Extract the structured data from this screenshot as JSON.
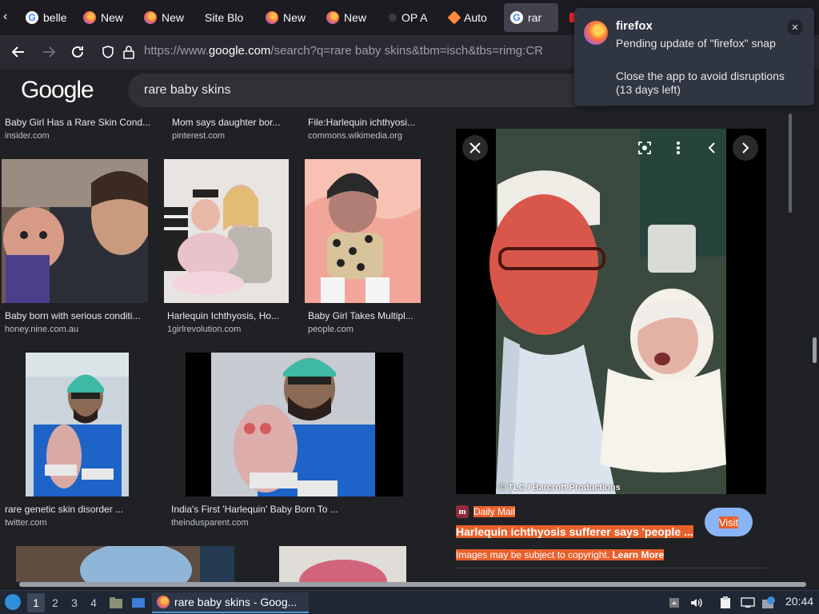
{
  "tabs": [
    {
      "label": "belle",
      "icon": "google-icon"
    },
    {
      "label": "New",
      "icon": "firefox-icon"
    },
    {
      "label": "New",
      "icon": "firefox-icon"
    },
    {
      "label": "Site Blo",
      "icon": "none"
    },
    {
      "label": "New",
      "icon": "firefox-icon"
    },
    {
      "label": "New",
      "icon": "firefox-icon"
    },
    {
      "label": "OP A",
      "icon": "dot-icon"
    },
    {
      "label": "Auto",
      "icon": "diamond-icon"
    },
    {
      "label": "rar",
      "icon": "google-icon",
      "active": true
    }
  ],
  "navbar": {
    "url_prefix": "https://www.",
    "url_host": "google.com",
    "url_path": "/search?q=rare baby skins&tbm=isch&tbs=rimg:CR"
  },
  "google": {
    "logo": "Google",
    "query": "rare baby skins"
  },
  "results": [
    {
      "title": "Baby Girl Has a Rare Skin Cond...",
      "source": "insider.com"
    },
    {
      "title": "Mom says daughter bor...",
      "source": "pinterest.com"
    },
    {
      "title": "File:Harlequin ichthyosi...",
      "source": "commons.wikimedia.org"
    },
    {
      "title": "Baby born with serious conditi...",
      "source": "honey.nine.com.au"
    },
    {
      "title": "Harlequin Ichthyosis, Ho...",
      "source": "1girlrevolution.com"
    },
    {
      "title": "Baby Girl Takes Multipl...",
      "source": "people.com"
    },
    {
      "title": "rare genetic skin disorder ...",
      "source": "twitter.com"
    },
    {
      "title": "India's First 'Harlequin' Baby Born To ...",
      "source": "theindusparent.com"
    }
  ],
  "preview": {
    "credit": "© TLC / Barcroft Productions",
    "site": "Daily Mail",
    "headline": "Harlequin ichthyosis sufferer says 'people ...",
    "copyright": "Images may be subject to copyright.",
    "learn_more": "Learn More",
    "visit": "Visit"
  },
  "notification": {
    "app": "firefox",
    "message": "Pending update of \"firefox\" snap",
    "detail": "Close the app to avoid disruptions (13 days left)"
  },
  "taskbar": {
    "workspaces": [
      "1",
      "2",
      "3",
      "4"
    ],
    "active_window": "rare baby skins - Goog...",
    "clock": "20:44"
  },
  "colors": {
    "highlight": "#e8602c",
    "visit_button": "#8ab4f8",
    "background": "#202124"
  }
}
